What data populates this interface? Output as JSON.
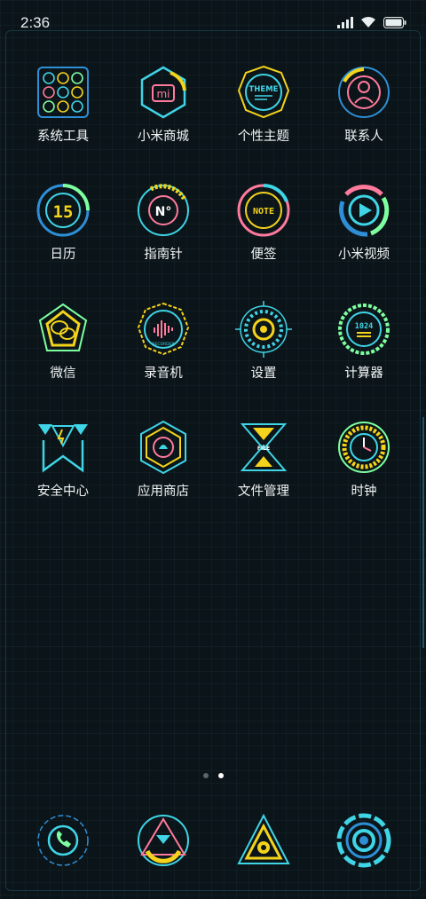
{
  "status_bar": {
    "time": "2:36",
    "icons": [
      "signal-icon",
      "wifi-icon",
      "battery-icon"
    ]
  },
  "apps": [
    {
      "name": "system-tools",
      "label": "系统工具",
      "icon": "system-tools-icon"
    },
    {
      "name": "mi-store",
      "label": "小米商城",
      "icon": "mi-store-icon"
    },
    {
      "name": "themes",
      "label": "个性主题",
      "icon": "theme-icon",
      "icon_text": "THEME"
    },
    {
      "name": "contacts",
      "label": "联系人",
      "icon": "contacts-icon"
    },
    {
      "name": "calendar",
      "label": "日历",
      "icon": "calendar-icon",
      "icon_text": "15"
    },
    {
      "name": "compass",
      "label": "指南针",
      "icon": "compass-icon",
      "icon_text": "N°"
    },
    {
      "name": "notes",
      "label": "便签",
      "icon": "notes-icon",
      "icon_text": "NOTE"
    },
    {
      "name": "mi-video",
      "label": "小米视频",
      "icon": "video-icon"
    },
    {
      "name": "wechat",
      "label": "微信",
      "icon": "wechat-icon"
    },
    {
      "name": "recorder",
      "label": "录音机",
      "icon": "recorder-icon",
      "icon_text": "RECORDER"
    },
    {
      "name": "settings",
      "label": "设置",
      "icon": "settings-icon"
    },
    {
      "name": "calculator",
      "label": "计算器",
      "icon": "calculator-icon",
      "icon_text": "1024"
    },
    {
      "name": "security",
      "label": "安全中心",
      "icon": "security-icon"
    },
    {
      "name": "app-store",
      "label": "应用商店",
      "icon": "app-store-icon"
    },
    {
      "name": "file-manager",
      "label": "文件管理",
      "icon": "file-icon",
      "icon_text": "FILE"
    },
    {
      "name": "clock",
      "label": "时钟",
      "icon": "clock-icon"
    }
  ],
  "page_indicator": {
    "count": 2,
    "active_index": 1
  },
  "dock": [
    {
      "name": "phone",
      "icon": "phone-icon"
    },
    {
      "name": "messages",
      "icon": "messages-icon"
    },
    {
      "name": "browser",
      "icon": "browser-icon"
    },
    {
      "name": "camera",
      "icon": "camera-icon"
    }
  ],
  "colors": {
    "cyan": "#3fd4e6",
    "yellow": "#f3d31b",
    "pink": "#ff7a9c",
    "green": "#7dffa0",
    "blue": "#2e8fd6",
    "background": "#0b1418"
  }
}
